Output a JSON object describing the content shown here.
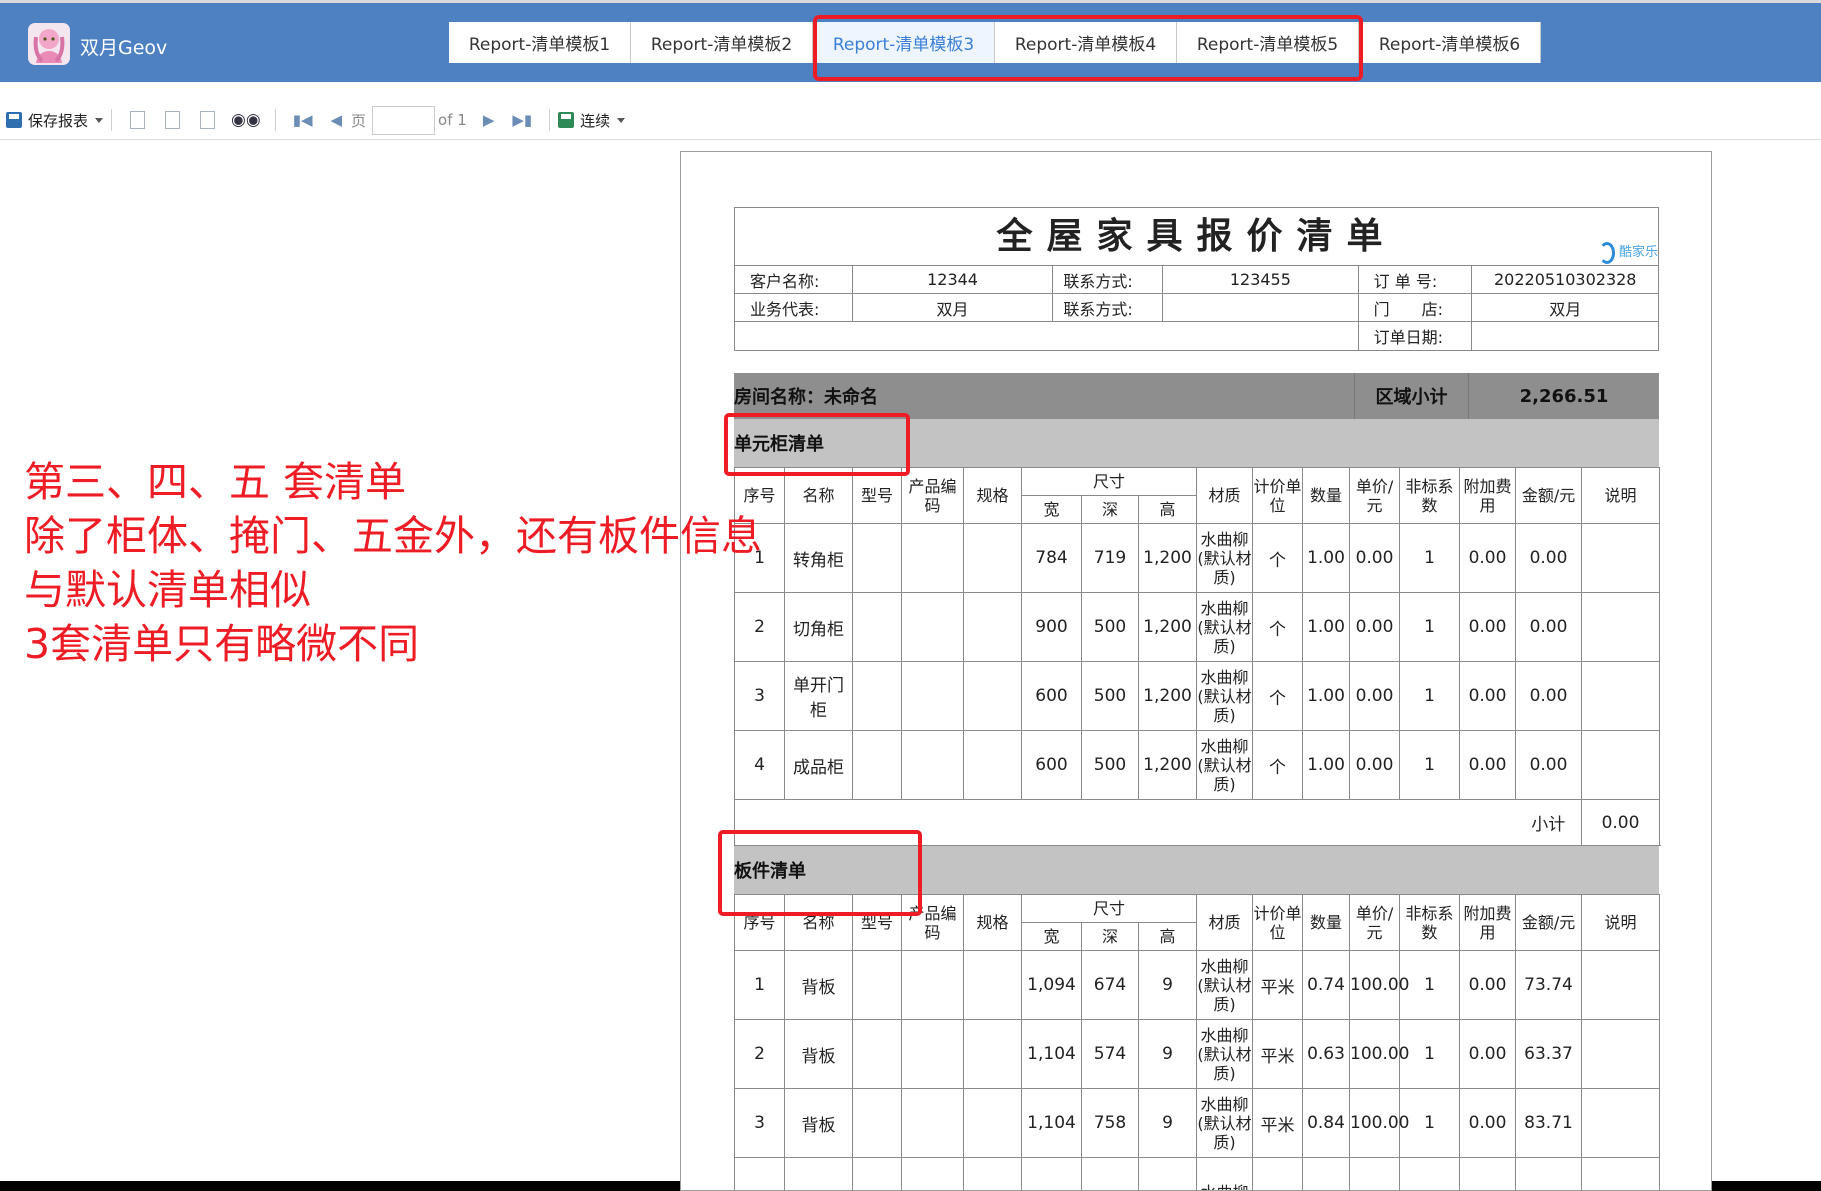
{
  "app": {
    "title": "双月Geov"
  },
  "tabs": [
    {
      "label": "Report-清单模板1"
    },
    {
      "label": "Report-清单模板2"
    },
    {
      "label": "Report-清单模板3"
    },
    {
      "label": "Report-清单模板4"
    },
    {
      "label": "Report-清单模板5"
    },
    {
      "label": "Report-清单模板6"
    }
  ],
  "toolbar": {
    "save_label": "保存报表",
    "page_label": "页",
    "page_value": "",
    "page_of": "of 1",
    "continuous_label": "连续"
  },
  "annotation": {
    "lines": [
      "第三、四、五 套清单",
      "除了柜体、掩门、五金外，还有板件信息",
      "与默认清单相似",
      "3套清单只有略微不同"
    ]
  },
  "report": {
    "title": "全屋家具报价清单",
    "brand_text": "酷家乐",
    "info": {
      "customer_label": "客户名称:",
      "customer": "12344",
      "contact_label": "联系方式:",
      "contact": "123455",
      "order_label": "订 单 号:",
      "order": "20220510302328",
      "rep_label": "业务代表:",
      "rep": "双月",
      "contact2_label": "联系方式:",
      "contact2": "",
      "store_label": "门　　店:",
      "store": "双月",
      "date_label": "订单日期:",
      "date": ""
    },
    "room": {
      "label": "房间名称：未命名",
      "subtotal_label": "区域小计",
      "subtotal": "2,266.51"
    },
    "headers": {
      "seq": "序号",
      "name": "名称",
      "model": "型号",
      "code": "产品编码",
      "spec": "规格",
      "size": "尺寸",
      "w": "宽",
      "d": "深",
      "h": "高",
      "material": "材质",
      "unit": "计价单位",
      "qty": "数量",
      "price": "单价/元",
      "nonstd": "非标系数",
      "extra": "附加费用",
      "amount": "金额/元",
      "note": "说明"
    },
    "cabinet_section": {
      "title": "单元柜清单",
      "rows": [
        {
          "seq": "1",
          "name": "转角柜",
          "w": "784",
          "d": "719",
          "h": "1,200",
          "material": "水曲柳(默认材质)",
          "unit": "个",
          "qty": "1.00",
          "price": "0.00",
          "nonstd": "1",
          "extra": "0.00",
          "amount": "0.00"
        },
        {
          "seq": "2",
          "name": "切角柜",
          "w": "900",
          "d": "500",
          "h": "1,200",
          "material": "水曲柳(默认材质)",
          "unit": "个",
          "qty": "1.00",
          "price": "0.00",
          "nonstd": "1",
          "extra": "0.00",
          "amount": "0.00"
        },
        {
          "seq": "3",
          "name": "单开门柜",
          "w": "600",
          "d": "500",
          "h": "1,200",
          "material": "水曲柳(默认材质)",
          "unit": "个",
          "qty": "1.00",
          "price": "0.00",
          "nonstd": "1",
          "extra": "0.00",
          "amount": "0.00"
        },
        {
          "seq": "4",
          "name": "成品柜",
          "w": "600",
          "d": "500",
          "h": "1,200",
          "material": "水曲柳(默认材质)",
          "unit": "个",
          "qty": "1.00",
          "price": "0.00",
          "nonstd": "1",
          "extra": "0.00",
          "amount": "0.00"
        }
      ],
      "subtotal_label": "小计",
      "subtotal": "0.00"
    },
    "panel_section": {
      "title": "板件清单",
      "rows": [
        {
          "seq": "1",
          "name": "背板",
          "w": "1,094",
          "d": "674",
          "h": "9",
          "material": "水曲柳(默认材质)",
          "unit": "平米",
          "qty": "0.74",
          "price": "100.00",
          "nonstd": "1",
          "extra": "0.00",
          "amount": "73.74"
        },
        {
          "seq": "2",
          "name": "背板",
          "w": "1,104",
          "d": "574",
          "h": "9",
          "material": "水曲柳(默认材质)",
          "unit": "平米",
          "qty": "0.63",
          "price": "100.00",
          "nonstd": "1",
          "extra": "0.00",
          "amount": "63.37"
        },
        {
          "seq": "3",
          "name": "背板",
          "w": "1,104",
          "d": "758",
          "h": "9",
          "material": "水曲柳(默认材质)",
          "unit": "平米",
          "qty": "0.84",
          "price": "100.00",
          "nonstd": "1",
          "extra": "0.00",
          "amount": "83.71"
        },
        {
          "seq": "",
          "name": "",
          "w": "",
          "d": "",
          "h": "",
          "material": "水曲柳",
          "unit": "",
          "qty": "",
          "price": "",
          "nonstd": "",
          "extra": "",
          "amount": ""
        }
      ]
    }
  },
  "colors": {
    "header_bg": "#4d81c2",
    "active_tab_text": "#3b7fd8",
    "highlight_red": "#ee1c25",
    "room_bar": "#8e8e8e",
    "section_bar": "#c3c3c3"
  }
}
